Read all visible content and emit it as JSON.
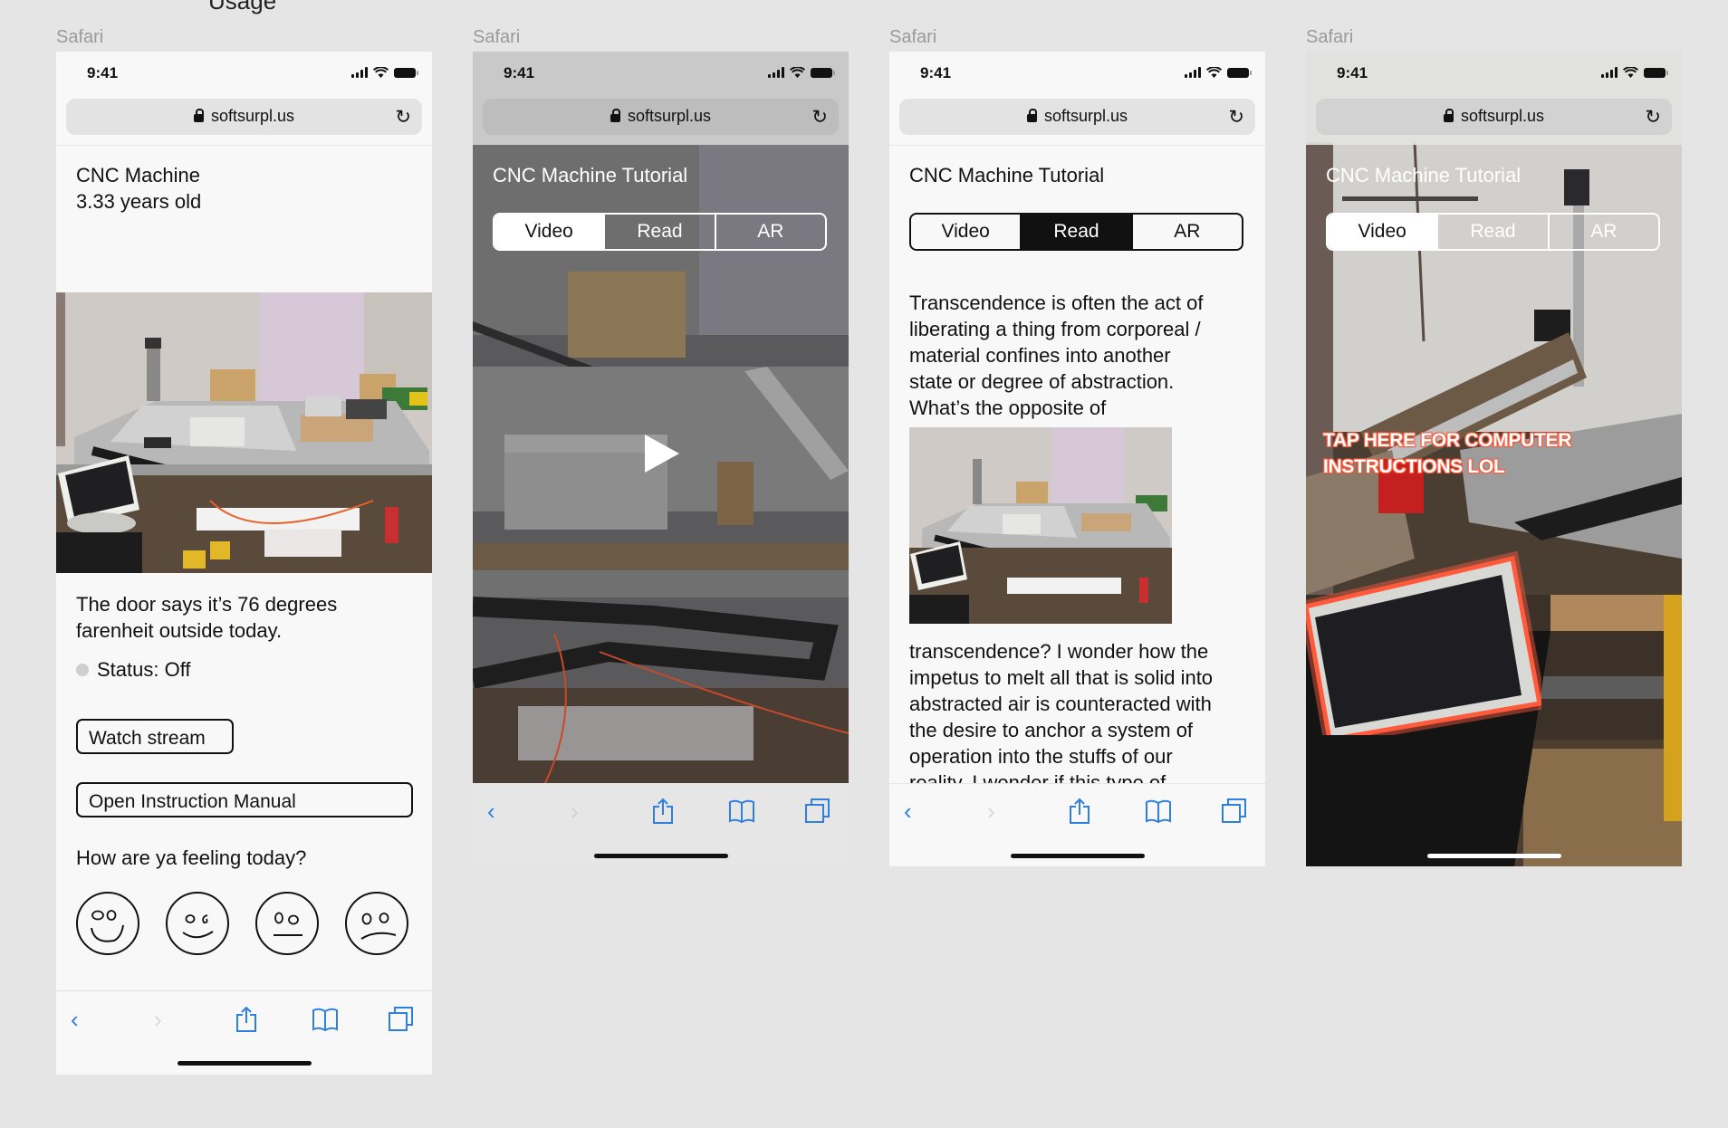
{
  "section_title": "Usage",
  "frame_label": "Safari",
  "status": {
    "time": "9:41"
  },
  "browser": {
    "url": "softsurpl.us"
  },
  "toolbar_icons": [
    "chevron-left-icon",
    "chevron-right-icon",
    "share-icon",
    "bookmarks-icon",
    "tabs-icon"
  ],
  "screen1": {
    "title": "CNC Machine",
    "age": "3.33 years old",
    "photo_alt": "CNC machine in workshop",
    "weather_line1": "The door says it’s 76 degrees",
    "weather_line2": "farenheit outside today.",
    "status_text": "Status: Off",
    "status_color": "#cfcfcf",
    "watch_stream": "Watch stream",
    "open_manual": "Open Instruction Manual",
    "feeling_prompt": "How are ya feeling today?",
    "moods": [
      "very-happy",
      "happy",
      "neutral",
      "sad"
    ]
  },
  "tutorial": {
    "title": "CNC Machine Tutorial",
    "tabs": [
      "Video",
      "Read",
      "AR"
    ]
  },
  "screen2": {
    "active_tab": "Video",
    "play_icon": "play-icon"
  },
  "screen3": {
    "active_tab": "Read",
    "para_lines": [
      "Transcendence is often the act of",
      "liberating a thing from corporeal /",
      "material confines into another",
      "state or degree of abstraction.",
      "What’s the opposite of"
    ],
    "para2_lines": [
      "transcendence? I wonder how the",
      "impetus to melt all that is solid into",
      "abstracted air is counteracted with",
      "the desire to anchor a system of",
      "operation into the stuffs of our",
      "reality. I wonder if this type of"
    ]
  },
  "screen4": {
    "active_tab": "Video",
    "ar_line1": "TAP HERE FOR COMPUTER",
    "ar_line2": "INSTRUCTIONS LOL",
    "ar_highlight_color": "#ff5a3c"
  }
}
